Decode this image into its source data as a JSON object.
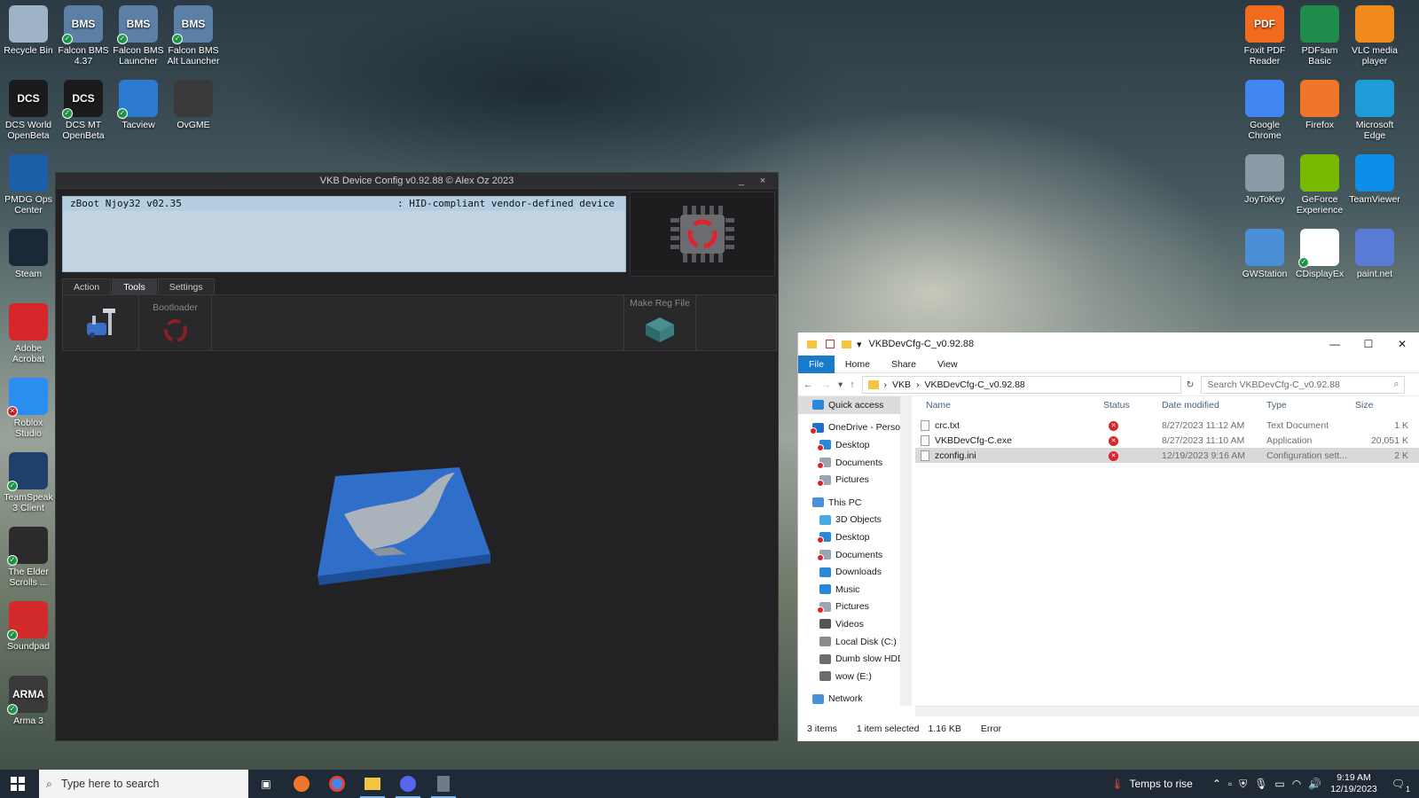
{
  "desktop": {
    "left_icons": [
      {
        "label": "Recycle Bin",
        "name": "recycle-bin-icon",
        "color": "#9eb3c6",
        "text": "",
        "badge": ""
      },
      {
        "label": "Falcon BMS 4.37",
        "name": "falcon-bms-icon",
        "color": "#5b7fa5",
        "text": "BMS",
        "badge": "ok"
      },
      {
        "label": "Falcon BMS Launcher",
        "name": "falcon-bms-launcher-icon",
        "color": "#5b7fa5",
        "text": "BMS",
        "badge": "ok"
      },
      {
        "label": "Falcon BMS Alt Launcher",
        "name": "falcon-bms-alt-launcher-icon",
        "color": "#5b7fa5",
        "text": "BMS",
        "badge": "ok"
      },
      {
        "label": "DCS World OpenBeta",
        "name": "dcs-world-icon",
        "color": "#1b1b1b",
        "text": "DCS",
        "badge": ""
      },
      {
        "label": "DCS MT OpenBeta",
        "name": "dcs-mt-icon",
        "color": "#1b1b1b",
        "text": "DCS",
        "badge": "ok"
      },
      {
        "label": "Tacview",
        "name": "tacview-icon",
        "color": "#2d7bd1",
        "text": "",
        "badge": "ok"
      },
      {
        "label": "OvGME",
        "name": "ovgme-icon",
        "color": "#3a3a3a",
        "text": "",
        "badge": ""
      },
      {
        "label": "PMDG Ops Center",
        "name": "pmdg-ops-center-icon",
        "color": "#1b5fa8",
        "text": "",
        "badge": ""
      },
      {
        "label": "Steam",
        "name": "steam-icon",
        "color": "#1b2838",
        "text": "",
        "badge": ""
      },
      {
        "label": "Adobe Acrobat",
        "name": "adobe-acrobat-icon",
        "color": "#d7262a",
        "text": "",
        "badge": ""
      },
      {
        "label": "Roblox Studio",
        "name": "roblox-studio-icon",
        "color": "#2a8ef0",
        "text": "",
        "badge": "err"
      },
      {
        "label": "TeamSpeak 3 Client",
        "name": "teamspeak-icon",
        "color": "#20406c",
        "text": "",
        "badge": "ok"
      },
      {
        "label": "The Elder Scrolls ...",
        "name": "elder-scrolls-icon",
        "color": "#2b2b2b",
        "text": "",
        "badge": "ok"
      },
      {
        "label": "Soundpad",
        "name": "soundpad-icon",
        "color": "#d22a2a",
        "text": "",
        "badge": "ok"
      },
      {
        "label": "Arma 3",
        "name": "arma3-icon",
        "color": "#3a3a3a",
        "text": "ARMA",
        "badge": "ok"
      }
    ],
    "right_icons": [
      {
        "label": "Foxit PDF Reader",
        "name": "foxit-pdf-reader-icon",
        "color": "#f26b1d",
        "text": "PDF",
        "badge": ""
      },
      {
        "label": "PDFsam Basic",
        "name": "pdfsam-basic-icon",
        "color": "#1e8c4b",
        "text": "",
        "badge": ""
      },
      {
        "label": "VLC media player",
        "name": "vlc-icon",
        "color": "#f08a1c",
        "text": "",
        "badge": ""
      },
      {
        "label": "Google Chrome",
        "name": "google-chrome-icon",
        "color": "#4286f4",
        "text": "",
        "badge": ""
      },
      {
        "label": "Firefox",
        "name": "firefox-icon",
        "color": "#f0772a",
        "text": "",
        "badge": ""
      },
      {
        "label": "Microsoft Edge",
        "name": "microsoft-edge-icon",
        "color": "#1f9bd8",
        "text": "",
        "badge": ""
      },
      {
        "label": "JoyToKey",
        "name": "joytokey-icon",
        "color": "#8c9aa8",
        "text": "",
        "badge": ""
      },
      {
        "label": "GeForce Experience",
        "name": "geforce-experience-icon",
        "color": "#76b900",
        "text": "",
        "badge": ""
      },
      {
        "label": "TeamViewer",
        "name": "teamviewer-icon",
        "color": "#0e8ee9",
        "text": "",
        "badge": ""
      },
      {
        "label": "GWStation",
        "name": "gwstation-icon",
        "color": "#4a90d9",
        "text": "",
        "badge": ""
      },
      {
        "label": "CDisplayEx",
        "name": "cdisplayex-icon",
        "color": "#ffffff",
        "text": "",
        "badge": "ok"
      },
      {
        "label": "paint.net",
        "name": "paintnet-icon",
        "color": "#5a7bd5",
        "text": "",
        "badge": ""
      }
    ]
  },
  "vkb": {
    "title": "VKB Device Config v0.92.88  © Alex Oz 2023",
    "minimize": "_",
    "close": "×",
    "device_name": "zBoot Njoy32 v02.35",
    "device_type": ": HID-compliant vendor-defined device",
    "tabs": [
      {
        "label": "Action",
        "active": false
      },
      {
        "label": "Tools",
        "active": true
      },
      {
        "label": "Settings",
        "active": false
      }
    ],
    "bootloader_label": "Bootloader",
    "make_reg_file_label": "Make Reg File"
  },
  "explorer": {
    "title": "VKBDevCfg-C_v0.92.88",
    "ribbon_tabs": [
      "File",
      "Home",
      "Share",
      "View"
    ],
    "breadcrumb": [
      "VKB",
      "VKBDevCfg-C_v0.92.88"
    ],
    "search_placeholder": "Search VKBDevCfg-C_v0.92.88",
    "nav": [
      {
        "label": "Quick access",
        "level": 0,
        "color": "#2b88d8",
        "err": false
      },
      {
        "label": "OneDrive - Person",
        "level": 0,
        "color": "#1e6fc7",
        "err": true
      },
      {
        "label": "Desktop",
        "level": 1,
        "color": "#2b88d8",
        "err": true
      },
      {
        "label": "Documents",
        "level": 1,
        "color": "#9aa5b1",
        "err": true
      },
      {
        "label": "Pictures",
        "level": 1,
        "color": "#9aa5b1",
        "err": true
      },
      {
        "label": "This PC",
        "level": 0,
        "color": "#4a90d9",
        "err": false
      },
      {
        "label": "3D Objects",
        "level": 1,
        "color": "#49a9e0",
        "err": false
      },
      {
        "label": "Desktop",
        "level": 1,
        "color": "#2b88d8",
        "err": true
      },
      {
        "label": "Documents",
        "level": 1,
        "color": "#9aa5b1",
        "err": true
      },
      {
        "label": "Downloads",
        "level": 1,
        "color": "#2b88d8",
        "err": false
      },
      {
        "label": "Music",
        "level": 1,
        "color": "#2b88d8",
        "err": false
      },
      {
        "label": "Pictures",
        "level": 1,
        "color": "#9aa5b1",
        "err": true
      },
      {
        "label": "Videos",
        "level": 1,
        "color": "#555555",
        "err": false
      },
      {
        "label": "Local Disk (C:)",
        "level": 1,
        "color": "#8a8a8a",
        "err": false
      },
      {
        "label": "Dumb slow HDD",
        "level": 1,
        "color": "#6d6d6d",
        "err": false
      },
      {
        "label": "wow (E:)",
        "level": 1,
        "color": "#6d6d6d",
        "err": false
      },
      {
        "label": "Network",
        "level": 0,
        "color": "#4a90d9",
        "err": false
      }
    ],
    "columns": {
      "name": "Name",
      "status": "Status",
      "date": "Date modified",
      "type": "Type",
      "size": "Size"
    },
    "files": [
      {
        "name": "crc.txt",
        "date": "8/27/2023 11:12 AM",
        "type": "Text Document",
        "size": "1 K",
        "selected": false
      },
      {
        "name": "VKBDevCfg-C.exe",
        "date": "8/27/2023 11:10 AM",
        "type": "Application",
        "size": "20,051 K",
        "selected": false
      },
      {
        "name": "zconfig.ini",
        "date": "12/19/2023 9:16 AM",
        "type": "Configuration sett...",
        "size": "2 K",
        "selected": true
      }
    ],
    "status_items": "3 items",
    "status_selected": "1 item selected",
    "status_size": "1.16 KB",
    "status_error": "Error"
  },
  "taskbar": {
    "search_placeholder": "Type here to search",
    "weather": "Temps to rise",
    "time": "9:19 AM",
    "date": "12/19/2023",
    "notification_count": "1"
  }
}
